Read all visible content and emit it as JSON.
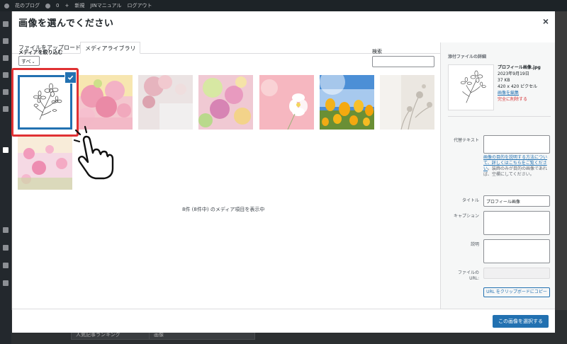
{
  "admin_bar": {
    "items": [
      "花のブログ",
      "0",
      "新規",
      "JINマニュアル",
      "ログアウト"
    ]
  },
  "modal": {
    "title": "画像を選んでください",
    "close_label": "×",
    "tabs": [
      {
        "label": "ファイルをアップロード",
        "active": false
      },
      {
        "label": "メディアライブラリ",
        "active": true
      }
    ],
    "filter": {
      "label": "メディアを絞り込む",
      "selected": "すべ"
    },
    "search": {
      "label": "検索",
      "value": ""
    },
    "count_text": "8件 (8件中) のメディア項目を表示中",
    "select_button": "この画像を選択する"
  },
  "media_items": [
    {
      "name": "flower-line-drawing-icon",
      "selected": true
    },
    {
      "name": "pink-flowers-water",
      "selected": false
    },
    {
      "name": "pink-carnations",
      "selected": false
    },
    {
      "name": "colorful-flowers",
      "selected": false
    },
    {
      "name": "pink-cosmos",
      "selected": false
    },
    {
      "name": "tulip-field",
      "selected": false
    },
    {
      "name": "flower-shadow",
      "selected": false
    },
    {
      "name": "cosmos-field",
      "selected": false
    }
  ],
  "details": {
    "heading": "添付ファイルの詳細",
    "filename": "プロフィール画像.jpg",
    "date": "2023年9月19日",
    "size": "37 KB",
    "dimensions": "420 x 420 ピクセル",
    "edit_link": "画像を編集",
    "delete_link": "完全に削除する",
    "alt_label": "代替テキスト",
    "alt_value": "",
    "help_link": "画像の目的を説明する方法について、詳しくはこちらをご覧ください",
    "help_text": "。装飾のみが目的の画像であれば、空欄にしてください。",
    "title_label": "タイトル",
    "title_value": "プロフィール画像",
    "caption_label": "キャプション",
    "caption_value": "",
    "description_label": "説明",
    "description_value": "",
    "url_label_1": "ファイルの",
    "url_label_2": "URL:",
    "url_value": "",
    "copy_button": "URL をクリップボードにコピー"
  },
  "background": {
    "widget_1": "人気記事ランキング",
    "widget_2": "画像"
  },
  "colors": {
    "primary": "#2271b1",
    "highlight": "#e03133",
    "danger": "#d63638"
  }
}
